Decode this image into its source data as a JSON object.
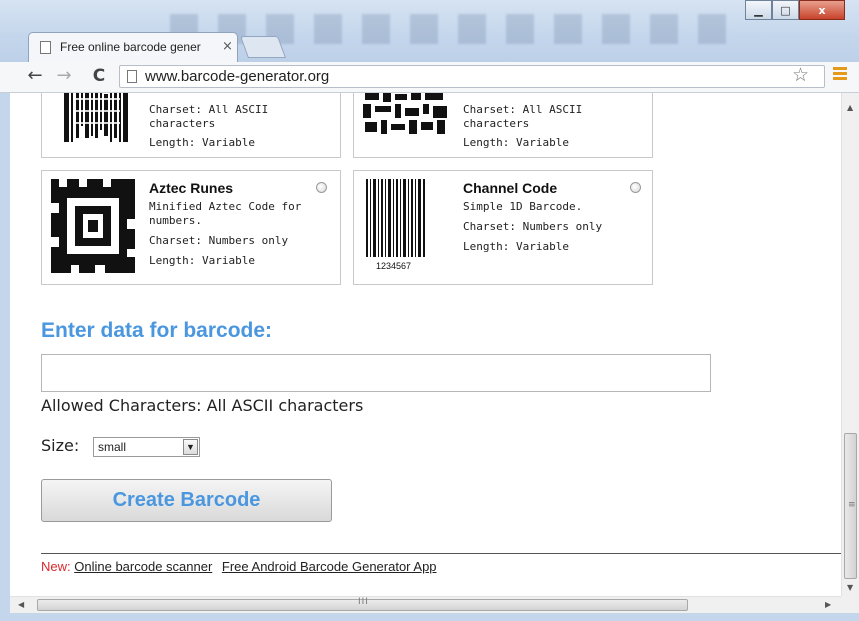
{
  "browser": {
    "tab_title": "Free online barcode gener",
    "tab_close": "×",
    "url": "www.barcode-generator.org",
    "back": "←",
    "forward": "→",
    "reload": "C",
    "star": "☆",
    "window_buttons": {
      "minimize": "▁",
      "maximize": "□",
      "close": "x"
    }
  },
  "barcode_options": [
    {
      "name": "",
      "charset": "Charset: All ASCII characters",
      "length": "Length: Variable",
      "image": "pdf417-barcode-image"
    },
    {
      "name": "",
      "charset": "Charset: All ASCII characters",
      "length": "Length: Variable",
      "image": "2d-matrix-barcode-image"
    },
    {
      "name": "Aztec Runes",
      "description": "Minified Aztec Code for numbers.",
      "charset": "Charset: Numbers only",
      "length": "Length: Variable",
      "image": "aztec-runes-image",
      "selected": false
    },
    {
      "name": "Channel Code",
      "description": "Simple 1D Barcode.",
      "charset": "Charset: Numbers only",
      "length": "Length: Variable",
      "image": "channel-code-image",
      "image_caption": "1234567",
      "selected": false
    }
  ],
  "form": {
    "heading": "Enter data for barcode:",
    "input_value": "",
    "allowed_characters": "Allowed Characters: All ASCII characters",
    "size_label": "Size:",
    "size_value": "small",
    "create_button": "Create Barcode"
  },
  "footer": {
    "new_label": "New:",
    "links": [
      "Online barcode scanner",
      "Free Android Barcode Generator App"
    ]
  },
  "scrollbars": {
    "hgrip": "III",
    "vgrip": "≡"
  },
  "colors": {
    "heading": "#4a97e0",
    "new_label": "#d9292c",
    "accent_menu": "#e69a1c"
  }
}
